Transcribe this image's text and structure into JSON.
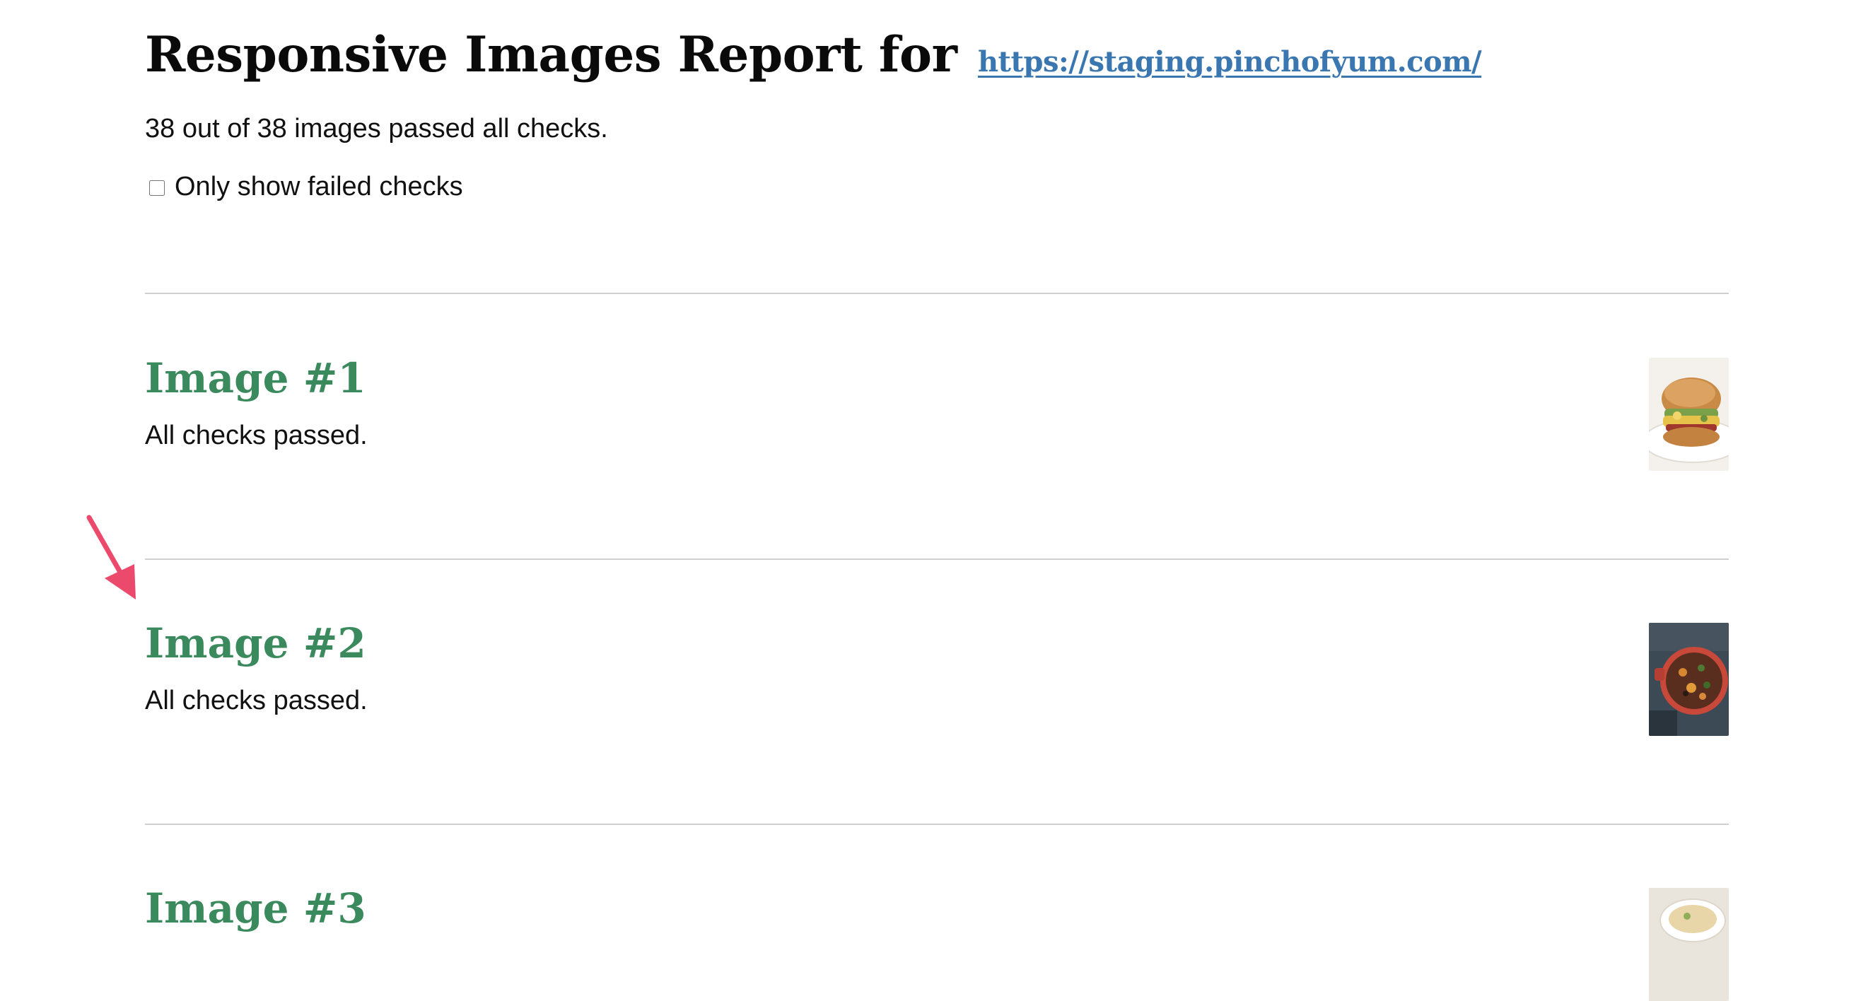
{
  "header": {
    "title_prefix": "Responsive Images Report for",
    "site_url": "https://staging.pinchofyum.com/"
  },
  "summary": "38 out of 38 images passed all checks.",
  "filter": {
    "label": "Only show failed checks",
    "checked": false
  },
  "images": [
    {
      "title": "Image #1",
      "status": "All checks passed.",
      "thumb": "sandwich-photo"
    },
    {
      "title": "Image #2",
      "status": "All checks passed.",
      "thumb": "stew-pot-photo"
    },
    {
      "title": "Image #3",
      "status": "",
      "thumb": "bowl-photo"
    }
  ],
  "colors": {
    "heading": "#0a0a0a",
    "link": "#3a76b0",
    "item_title": "#3b8a5e",
    "divider": "#d0d0d0",
    "annotation_arrow": "#ec4a6c"
  }
}
